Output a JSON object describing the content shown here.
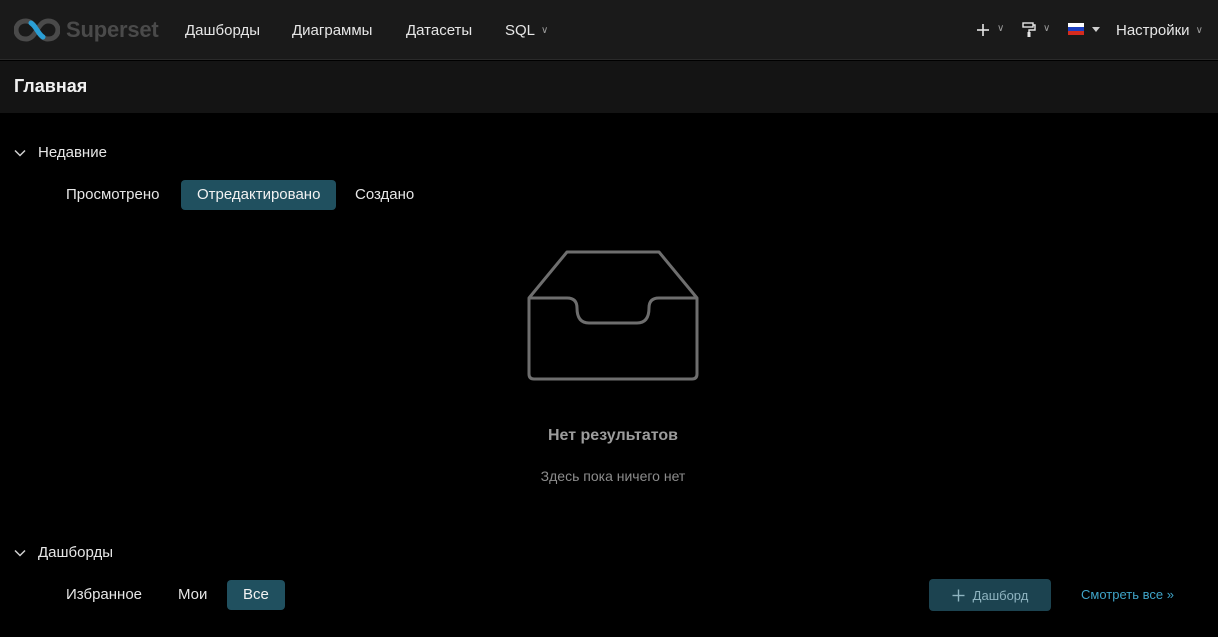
{
  "app": {
    "logo_text": "Superset"
  },
  "nav": {
    "items": [
      {
        "label": "Дашборды"
      },
      {
        "label": "Диаграммы"
      },
      {
        "label": "Датасеты"
      },
      {
        "label": "SQL"
      }
    ],
    "settings_label": "Настройки",
    "caret": "∨"
  },
  "page": {
    "title": "Главная"
  },
  "recent": {
    "label": "Недавние",
    "tabs": [
      {
        "label": "Просмотрено",
        "active": false
      },
      {
        "label": "Отредактировано",
        "active": true
      },
      {
        "label": "Создано",
        "active": false
      }
    ],
    "empty_title": "Нет результатов",
    "empty_description": "Здесь пока ничего нет"
  },
  "dashboards": {
    "label": "Дашборды",
    "tabs": [
      {
        "label": "Избранное",
        "active": false
      },
      {
        "label": "Мои",
        "active": false
      },
      {
        "label": "Все",
        "active": true
      }
    ],
    "add_button_label": "Дашборд",
    "view_all_label": "Смотреть все »"
  },
  "icons": {
    "logo": "superset-logo-icon",
    "add": "plus-icon",
    "theme": "paint-roller-icon",
    "language": "russia-flag-icon",
    "section_toggle": "chevron-down-icon",
    "empty": "empty-inbox-icon"
  },
  "colors": {
    "accent": "#20505f",
    "link": "#3fa4c8",
    "background": "#000000",
    "topbar": "#1a1a1a"
  }
}
